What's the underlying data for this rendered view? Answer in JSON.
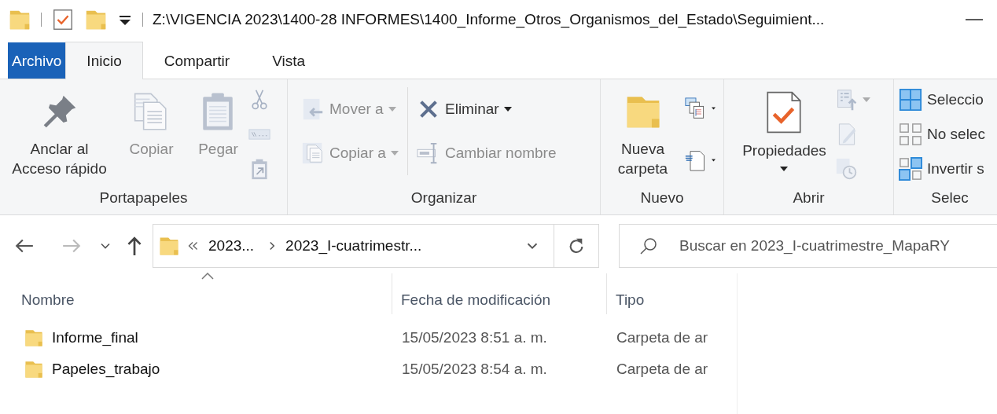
{
  "title_bar": {
    "path": "Z:\\VIGENCIA 2023\\1400-28 INFORMES\\1400_Informe_Otros_Organismos_del_Estado\\Seguimient..."
  },
  "tabs": [
    {
      "label": "Archivo",
      "kind": "file",
      "selected": false
    },
    {
      "label": "Inicio",
      "kind": "tab",
      "selected": true
    },
    {
      "label": "Compartir",
      "kind": "tab",
      "selected": false
    },
    {
      "label": "Vista",
      "kind": "tab",
      "selected": false
    }
  ],
  "ribbon": {
    "groups": [
      {
        "label": "Portapapeles",
        "columns": [
          [
            {
              "kind": "large",
              "label": "Anclar al\nAcceso rápido",
              "disabled": false,
              "dropdown": false
            }
          ],
          [
            {
              "kind": "large",
              "label": "Copiar",
              "disabled": true,
              "dropdown": false
            }
          ],
          [
            {
              "kind": "large",
              "label": "Pegar",
              "disabled": true,
              "dropdown": false
            }
          ],
          [
            {
              "kind": "icon",
              "disabled": true,
              "dropdown": false
            },
            {
              "kind": "icon",
              "disabled": true,
              "dropdown": false
            },
            {
              "kind": "icon",
              "disabled": true,
              "dropdown": false
            }
          ]
        ]
      },
      {
        "label": "Organizar",
        "columns": [
          [
            {
              "kind": "small",
              "label": "Mover a",
              "disabled": true,
              "dropdown": true
            },
            {
              "kind": "small",
              "label": "Copiar a",
              "disabled": true,
              "dropdown": true
            }
          ],
          [
            {
              "kind": "small",
              "label": "Eliminar",
              "disabled": false,
              "dropdown": true
            },
            {
              "kind": "small",
              "label": "Cambiar nombre",
              "disabled": true,
              "dropdown": false
            }
          ]
        ]
      },
      {
        "label": "Nuevo",
        "columns": [
          [
            {
              "kind": "large",
              "label": "Nueva\ncarpeta",
              "disabled": false,
              "dropdown": false
            }
          ],
          [
            {
              "kind": "icon",
              "disabled": false,
              "dropdown": true
            },
            {
              "kind": "icon",
              "disabled": false,
              "dropdown": true
            }
          ]
        ]
      },
      {
        "label": "Abrir",
        "columns": [
          [
            {
              "kind": "large",
              "label": "Propiedades",
              "disabled": false,
              "dropdown": true
            }
          ],
          [
            {
              "kind": "icon",
              "disabled": true,
              "dropdown": true
            },
            {
              "kind": "icon",
              "disabled": true,
              "dropdown": false
            },
            {
              "kind": "icon",
              "disabled": true,
              "dropdown": false
            }
          ]
        ]
      },
      {
        "label": "Selec",
        "columns": [
          [
            {
              "kind": "small",
              "label": "Seleccio",
              "disabled": false,
              "dropdown": false
            },
            {
              "kind": "small",
              "label": "No selec",
              "disabled": false,
              "dropdown": false
            },
            {
              "kind": "small",
              "label": "Invertir s",
              "disabled": false,
              "dropdown": false
            }
          ]
        ]
      }
    ]
  },
  "nav_buttons": [
    {
      "kind": "back",
      "disabled": false
    },
    {
      "kind": "forward",
      "disabled": true
    },
    {
      "kind": "recent",
      "disabled": false
    },
    {
      "kind": "up",
      "disabled": false
    }
  ],
  "address": {
    "crumbs": [
      "2023...",
      "2023_I-cuatrimestr..."
    ]
  },
  "search": {
    "placeholder": "Buscar en 2023_I-cuatrimestre_MapaRY"
  },
  "table": {
    "columns": [
      {
        "label": "Nombre",
        "sorted": true
      },
      {
        "label": "Fecha de modificación",
        "sorted": false
      },
      {
        "label": "Tipo",
        "sorted": false
      }
    ],
    "rows": [
      {
        "name": "Informe_final",
        "modified": "15/05/2023 8:51 a. m.",
        "type": "Carpeta de ar"
      },
      {
        "name": "Papeles_trabajo",
        "modified": "15/05/2023 8:54 a. m.",
        "type": "Carpeta de ar"
      }
    ]
  }
}
